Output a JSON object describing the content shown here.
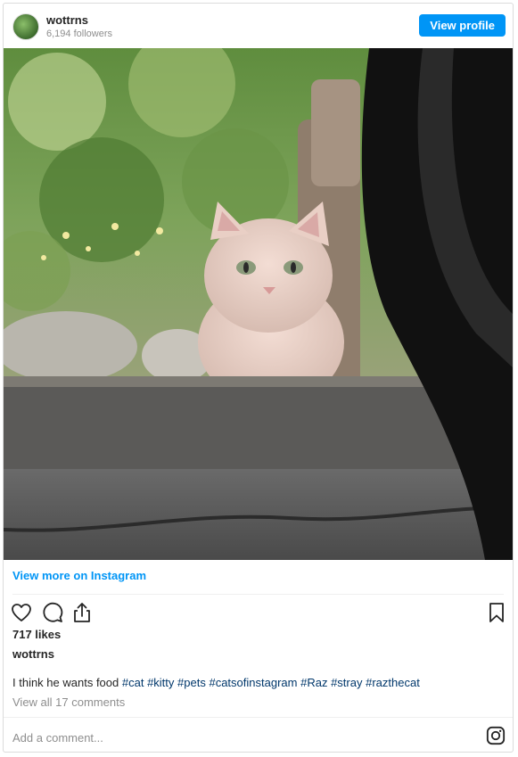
{
  "header": {
    "username": "wottrns",
    "followers": "6,194 followers",
    "view_profile_label": "View profile"
  },
  "post": {
    "image_alt": "cat looking through window",
    "view_more_label": "View more on Instagram",
    "likes": "717 likes",
    "caption_user": "wottrns",
    "caption_text": "I think he wants food ",
    "hashtags": [
      "#cat",
      "#kitty",
      "#pets",
      "#catsofinstagram",
      "#Raz",
      "#stray",
      "#razthecat"
    ],
    "view_comments_label": "View all 17 comments"
  },
  "comment_box": {
    "placeholder": "Add a comment..."
  },
  "icons": {
    "like": "heart-icon",
    "comment": "comment-icon",
    "share": "share-icon",
    "save": "bookmark-icon",
    "brand": "instagram-logo-icon"
  },
  "colors": {
    "accent": "#0095f6",
    "hashtag": "#00376b",
    "muted": "#8e8e8e"
  }
}
